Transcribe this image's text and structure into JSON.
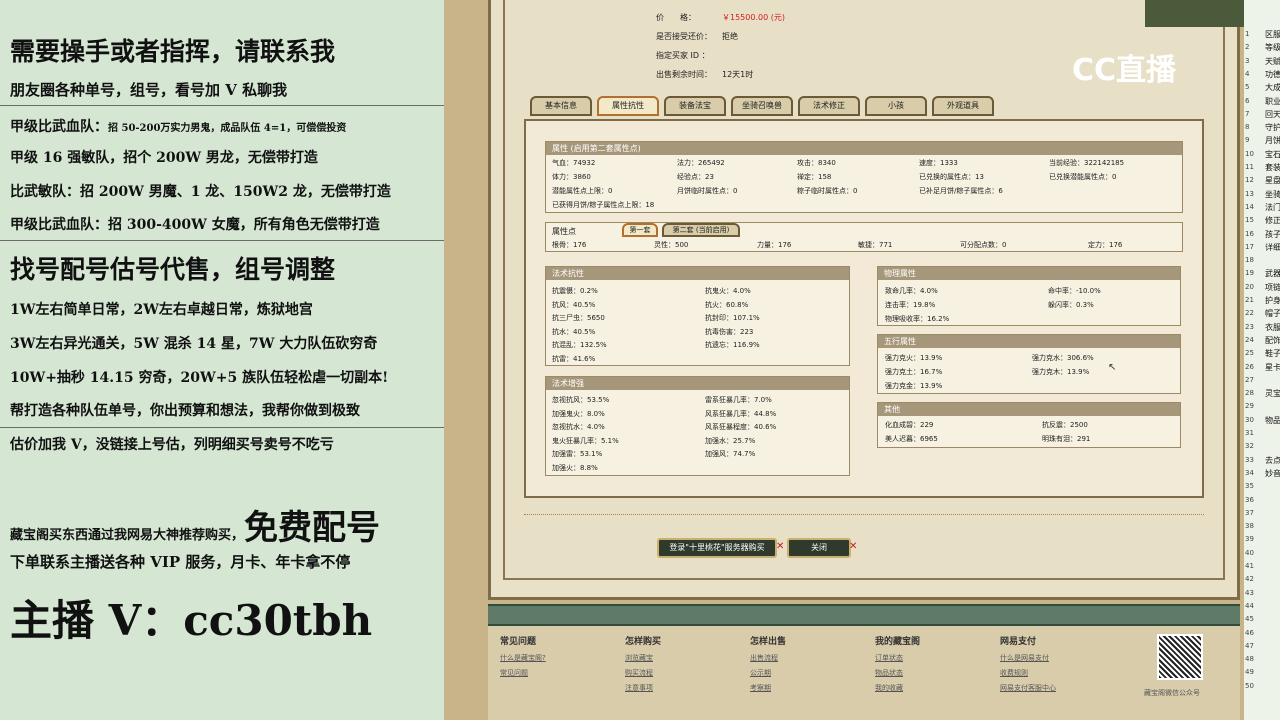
{
  "overlay": {
    "headline": "需要操手或者指挥，请联系我",
    "l2": "朋友圈各种单号，组号，看号加 V 私聊我",
    "l3": "甲级比武血队：",
    "l3b": "招 50-200万实力男鬼，成品队伍 4=1，可偿偿投资",
    "l4": "甲级 16 强敏队，招个 200W 男龙，无偿带打造",
    "l5": "比武敏队：招 200W 男魔、1 龙、150W2 龙，无偿带打造",
    "l6": "甲级比武血队：招 300-400W 女魔，所有角色无偿带打造",
    "l7": "找号配号估号代售，组号调整",
    "l8": "1W左右简单日常，2W左右卓越日常，炼狱地宫",
    "l9": "3W左右异光通关，5W 混杀 14 星，7W 大力队伍砍穷奇",
    "l10": "10W+抽秒 14.15 穷奇，20W+5 族队伍轻松虐一切副本!",
    "l11": "帮打造各种队伍单号，你出预算和想法，我帮你做到极致",
    "l12": "估价加我 V，没链接上号估，列明细买号卖号不吃亏",
    "l13a": "藏宝阁买东西通过我网易大神推荐购买，",
    "l13b": "免费配号",
    "l14": "下单联系主播送各种 VIP 服务，月卡、年卡拿不停",
    "l15": "主播 V：cc30tbh"
  },
  "logo": "CC直播",
  "listing": {
    "price_label": "价　　格：",
    "price": "￥15500.00 (元)",
    "bargain_label": "是否接受还价：",
    "bargain": "拒绝",
    "buyer_label": "指定买家 ID ：",
    "buyer": "",
    "remain_label": "出售剩余时间：",
    "remain": "12天1时"
  },
  "tabs": [
    "基本信息",
    "属性抗性",
    "装备法宝",
    "坐骑召唤兽",
    "法术修正",
    "小孩",
    "外观道具"
  ],
  "attr": {
    "title": "属性 (启用第二套属性点)",
    "rows": [
      [
        "气血：74932",
        "法力：265492",
        "攻击：8340",
        "速度：1333",
        "当前经验：322142185"
      ],
      [
        "体力：3860",
        "经验点：23",
        "禅定：158",
        "已兑换的属性点：13",
        "已兑换潜能属性点：0"
      ],
      [
        "潜能属性点上限：0",
        "月饼临时属性点：0",
        "粽子临时属性点：0",
        "已补足月饼/粽子属性点：6",
        ""
      ],
      [
        "已获得月饼/粽子属性点上限：18",
        "",
        "",
        "",
        ""
      ]
    ]
  },
  "points": {
    "title": "属性点",
    "sub1": "第一套",
    "sub2": "第二套 (当前启用)",
    "row": [
      "根骨：176",
      "灵性：500",
      "力量：176",
      "敏捷：771",
      "可分配点数：0",
      "定力：176"
    ]
  },
  "resist": {
    "title": "法术抗性",
    "items": [
      "抗震慑：0.2%",
      "抗鬼火：4.0%",
      "抗风：40.5%",
      "抗火：60.8%",
      "抗三尸虫：5650",
      "抗封印：107.1%",
      "抗水：40.5%",
      "抗毒伤害：223",
      "抗混乱：132.5%",
      "抗遗忘：116.9%",
      "抗雷：41.6%",
      ""
    ]
  },
  "boost": {
    "title": "法术增强",
    "items": [
      "忽视抗风：53.5%",
      "雷系狂暴几率：7.0%",
      "加强鬼火：8.0%",
      "风系狂暴几率：44.8%",
      "忽视抗水：4.0%",
      "风系狂暴程度：40.6%",
      "鬼火狂暴几率：5.1%",
      "加强水：25.7%",
      "加强雷：53.1%",
      "加强风：74.7%",
      "加强火：8.8%",
      ""
    ]
  },
  "phys": {
    "title": "物理属性",
    "items": [
      "致命几率：4.0%",
      "命中率：-10.0%",
      "连击率：19.8%",
      "躲闪率：0.3%",
      "物理吸收率：16.2%",
      ""
    ]
  },
  "five": {
    "title": "五行属性",
    "items": [
      "强力克火：13.9%",
      "强力克水：306.6%",
      "强力克土：16.7%",
      "强力克木：13.9%",
      "强力克金：13.9%",
      ""
    ]
  },
  "other": {
    "title": "其他",
    "items": [
      "化血成碧：229",
      "抗反震：2500",
      "美人迟暮：6965",
      "明珠有泪：291"
    ]
  },
  "buttons": {
    "login": "登录\"十里桃花\"服务器购买",
    "close": "关闭"
  },
  "footer": {
    "cols": [
      {
        "h": "常见问题",
        "links": [
          "什么是藏宝阁?",
          "常见问题"
        ]
      },
      {
        "h": "怎样购买",
        "links": [
          "浏览藏宝",
          "购买流程",
          "注意事项"
        ]
      },
      {
        "h": "怎样出售",
        "links": [
          "出售流程",
          "公示期",
          "考察期"
        ]
      },
      {
        "h": "我的藏宝阁",
        "links": [
          "订单状态",
          "物品状态",
          "我的收藏"
        ]
      },
      {
        "h": "网易支付",
        "links": [
          "什么是网易支付",
          "收费规则",
          "网易支付客服中心"
        ]
      }
    ],
    "qr": "藏宝阁微信公众号"
  },
  "sidebar": {
    "rows": [
      [
        "1",
        "区服"
      ],
      [
        "2",
        "等级"
      ],
      [
        "3",
        "天赋"
      ],
      [
        "4",
        "功德"
      ],
      [
        "5",
        "大成"
      ],
      [
        "6",
        "职业"
      ],
      [
        "7",
        "回天"
      ],
      [
        "8",
        "守护"
      ],
      [
        "9",
        "月饼"
      ],
      [
        "10",
        "宝石"
      ],
      [
        "11",
        "套装"
      ],
      [
        "12",
        "星盘"
      ],
      [
        "13",
        "坐骑"
      ],
      [
        "14",
        "法门"
      ],
      [
        "15",
        "修正"
      ],
      [
        "16",
        "孩子"
      ],
      [
        "17",
        "详细"
      ],
      [
        "18",
        ""
      ],
      [
        "19",
        "武器"
      ],
      [
        "20",
        "项链"
      ],
      [
        "21",
        "护身"
      ],
      [
        "22",
        "帽子"
      ],
      [
        "23",
        "衣服"
      ],
      [
        "24",
        "配饰"
      ],
      [
        "25",
        "鞋子"
      ],
      [
        "26",
        "星卡"
      ],
      [
        "27",
        ""
      ],
      [
        "28",
        "灵宝"
      ],
      [
        "29",
        ""
      ],
      [
        "30",
        "物品"
      ],
      [
        "31",
        ""
      ],
      [
        "32",
        ""
      ],
      [
        "33",
        "去点"
      ],
      [
        "34",
        "妙音"
      ],
      [
        "35",
        ""
      ],
      [
        "36",
        ""
      ],
      [
        "37",
        ""
      ],
      [
        "38",
        ""
      ],
      [
        "39",
        ""
      ],
      [
        "40",
        ""
      ],
      [
        "41",
        ""
      ],
      [
        "42",
        ""
      ],
      [
        "43",
        ""
      ],
      [
        "44",
        ""
      ],
      [
        "45",
        ""
      ],
      [
        "46",
        ""
      ],
      [
        "47",
        ""
      ],
      [
        "48",
        ""
      ],
      [
        "49",
        ""
      ],
      [
        "50",
        ""
      ]
    ]
  }
}
